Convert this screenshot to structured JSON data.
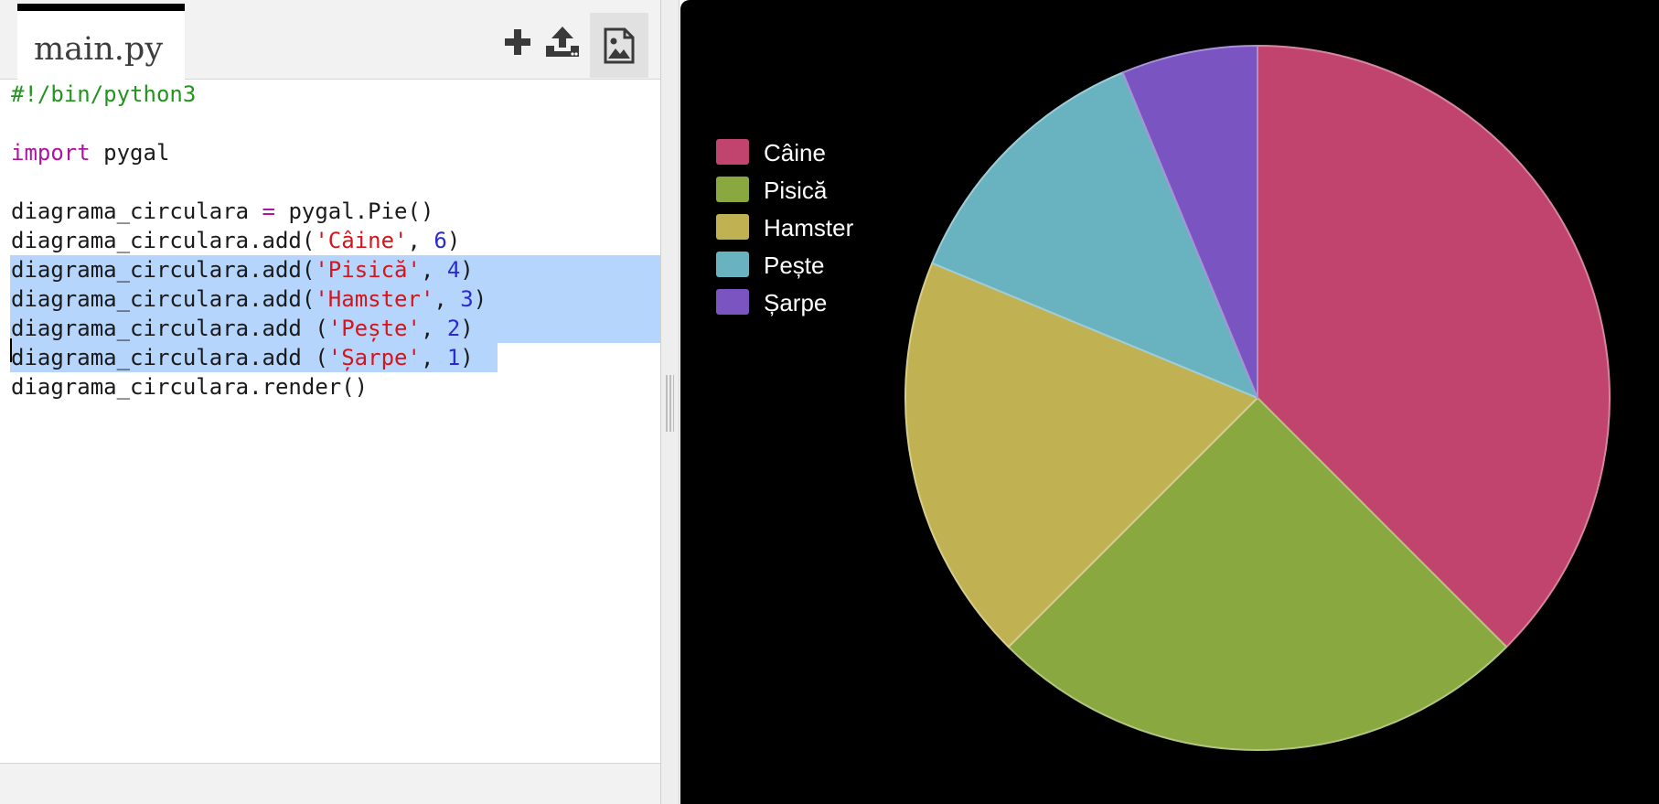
{
  "editor": {
    "tab_label": "main.py",
    "toolbar": {
      "add_icon": "plus-icon",
      "upload_icon": "upload-icon",
      "image_icon": "image-icon"
    },
    "code_lines": [
      [
        {
          "t": "#!/bin/python3",
          "c": "comment"
        }
      ],
      [],
      [
        {
          "t": "import",
          "c": "kw"
        },
        {
          "t": " pygal",
          "c": ""
        }
      ],
      [],
      [
        {
          "t": "diagrama_circulara ",
          "c": ""
        },
        {
          "t": "=",
          "c": "op"
        },
        {
          "t": " pygal.Pie()",
          "c": ""
        }
      ],
      [
        {
          "t": "diagrama_circulara.add(",
          "c": ""
        },
        {
          "t": "'Câine'",
          "c": "str"
        },
        {
          "t": ", ",
          "c": ""
        },
        {
          "t": "6",
          "c": "num"
        },
        {
          "t": ")",
          "c": ""
        }
      ],
      [
        {
          "t": "diagrama_circulara.add(",
          "c": ""
        },
        {
          "t": "'Pisică'",
          "c": "str"
        },
        {
          "t": ", ",
          "c": ""
        },
        {
          "t": "4",
          "c": "num"
        },
        {
          "t": ")",
          "c": ""
        }
      ],
      [
        {
          "t": "diagrama_circulara.add(",
          "c": ""
        },
        {
          "t": "'Hamster'",
          "c": "str"
        },
        {
          "t": ", ",
          "c": ""
        },
        {
          "t": "3",
          "c": "num"
        },
        {
          "t": ")",
          "c": ""
        }
      ],
      [
        {
          "t": "diagrama_circulara.add (",
          "c": ""
        },
        {
          "t": "'Pește'",
          "c": "str"
        },
        {
          "t": ", ",
          "c": ""
        },
        {
          "t": "2",
          "c": "num"
        },
        {
          "t": ")",
          "c": ""
        }
      ],
      [
        {
          "t": "diagrama_circulara.add (",
          "c": ""
        },
        {
          "t": "'Șarpe'",
          "c": "str"
        },
        {
          "t": ", ",
          "c": ""
        },
        {
          "t": "1",
          "c": "num"
        },
        {
          "t": ")",
          "c": ""
        }
      ],
      [
        {
          "t": "diagrama_circulara.render()",
          "c": ""
        }
      ]
    ],
    "selected_lines": [
      6,
      7,
      8,
      9
    ]
  },
  "chart_data": {
    "type": "pie",
    "background": "#000000",
    "legend_position": "top-left",
    "slices": [
      {
        "label": "Câine",
        "value": 6,
        "color": "#c1446f"
      },
      {
        "label": "Pisică",
        "value": 4,
        "color": "#89a83f"
      },
      {
        "label": "Hamster",
        "value": 3,
        "color": "#c0b252"
      },
      {
        "label": "Pește",
        "value": 2,
        "color": "#69b2c0"
      },
      {
        "label": "Șarpe",
        "value": 1,
        "color": "#7a55c1"
      }
    ]
  }
}
